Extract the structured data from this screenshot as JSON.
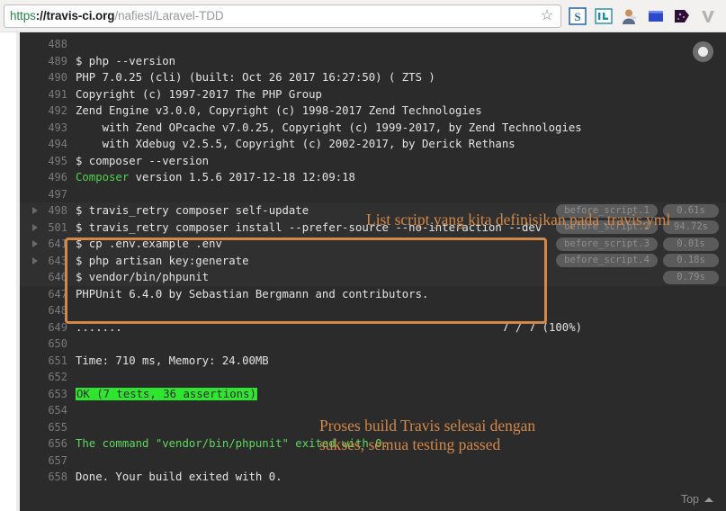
{
  "browser": {
    "url": {
      "scheme": "https",
      "host": "://travis-ci.org",
      "path": "/nafiesl/Laravel-TDD",
      "full": "https://travis-ci.org/nafiesl/Laravel-TDD"
    },
    "star_glyph": "☆",
    "toolbar_icons": [
      "skype-icon",
      "linkedin-icon",
      "avatar-icon",
      "blue-square-icon",
      "dark-app-icon",
      "vivaldi-v-icon"
    ]
  },
  "colors": {
    "log_background": "#2b2b2b",
    "log_row_alt": "#303030",
    "log_text": "#e4e4e4",
    "line_number": "#7a7a7a",
    "annotation": "#d2884b",
    "success_green": "#4fd14f",
    "ok_highlight": "#2ee62e",
    "badge_background": "#5b5b5b",
    "url_scheme": "#278446"
  },
  "log": {
    "scroll_button": "scroll-to-bottom",
    "top_link_label": "Top",
    "lines": [
      {
        "no": "488",
        "text": "",
        "arrow": false,
        "alt": false
      },
      {
        "no": "489",
        "text": "$ php --version",
        "arrow": false,
        "alt": false
      },
      {
        "no": "490",
        "text": "PHP 7.0.25 (cli) (built: Oct 26 2017 16:27:50) ( ZTS )",
        "arrow": false,
        "alt": false
      },
      {
        "no": "491",
        "text": "Copyright (c) 1997-2017 The PHP Group",
        "arrow": false,
        "alt": false
      },
      {
        "no": "492",
        "text": "Zend Engine v3.0.0, Copyright (c) 1998-2017 Zend Technologies",
        "arrow": false,
        "alt": false
      },
      {
        "no": "493",
        "text": "    with Zend OPcache v7.0.25, Copyright (c) 1999-2017, by Zend Technologies",
        "arrow": false,
        "alt": false
      },
      {
        "no": "494",
        "text": "    with Xdebug v2.5.5, Copyright (c) 2002-2017, by Derick Rethans",
        "arrow": false,
        "alt": false
      },
      {
        "no": "495",
        "text": "$ composer --version",
        "arrow": false,
        "alt": false
      },
      {
        "no": "496",
        "text": "version 1.5.6 2017-12-18 12:09:18",
        "prefix_green": "Composer",
        "arrow": false,
        "alt": false
      },
      {
        "no": "497",
        "text": "",
        "arrow": false,
        "alt": false
      },
      {
        "no": "498",
        "text": "$ travis_retry composer self-update",
        "arrow": true,
        "alt": true,
        "badge": "before_script.1",
        "time": "0.61s"
      },
      {
        "no": "501",
        "text": "$ travis_retry composer install --prefer-source --no-interaction --dev",
        "arrow": true,
        "alt": true,
        "badge": "before_script.2",
        "time": "94.72s"
      },
      {
        "no": "641",
        "text": "$ cp .env.example .env",
        "arrow": true,
        "alt": true,
        "badge": "before_script.3",
        "time": "0.01s"
      },
      {
        "no": "643",
        "text": "$ php artisan key:generate",
        "arrow": true,
        "alt": true,
        "badge": "before_script.4",
        "time": "0.18s"
      },
      {
        "no": "646",
        "text": "$ vendor/bin/phpunit",
        "arrow": false,
        "alt": true,
        "time": "0.79s"
      },
      {
        "no": "647",
        "text": "PHPUnit 6.4.0 by Sebastian Bergmann and contributors.",
        "arrow": false,
        "alt": false
      },
      {
        "no": "648",
        "text": "",
        "arrow": false,
        "alt": false
      },
      {
        "no": "649",
        "text": ".......",
        "right_text": "7 / 7 (100%)",
        "arrow": false,
        "alt": false
      },
      {
        "no": "650",
        "text": "",
        "arrow": false,
        "alt": false
      },
      {
        "no": "651",
        "text": "Time: 710 ms, Memory: 24.00MB",
        "arrow": false,
        "alt": false
      },
      {
        "no": "652",
        "text": "",
        "arrow": false,
        "alt": false
      },
      {
        "no": "653",
        "text": "OK (7 tests, 36 assertions)",
        "style": "ok-highlight",
        "arrow": false,
        "alt": false
      },
      {
        "no": "654",
        "text": "",
        "arrow": false,
        "alt": false
      },
      {
        "no": "655",
        "text": "",
        "arrow": false,
        "alt": false
      },
      {
        "no": "656",
        "text": "The command \"vendor/bin/phpunit\" exited with 0.",
        "style": "green",
        "arrow": false,
        "alt": false
      },
      {
        "no": "657",
        "text": "",
        "arrow": false,
        "alt": false
      },
      {
        "no": "658",
        "text": "Done. Your build exited with 0.",
        "arrow": false,
        "alt": false
      }
    ]
  },
  "annotations": {
    "top": "List script yang kita definisikan pada .travis.yml",
    "bottom_line1": "Proses build Travis selesai dengan",
    "bottom_line2": "sukses, semua testing passed"
  }
}
